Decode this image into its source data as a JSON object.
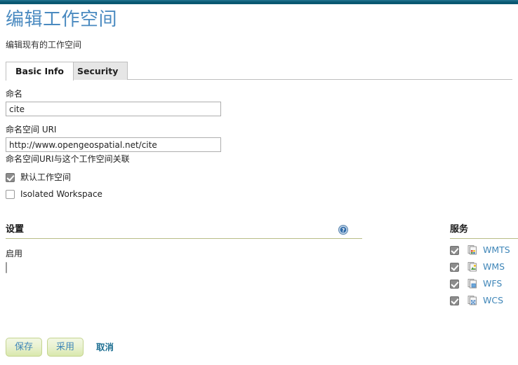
{
  "window": {
    "accent_color": "#0a5872"
  },
  "header": {
    "title": "编辑工作空间",
    "subtitle": "编辑现有的工作空间"
  },
  "tabs": [
    {
      "label": "Basic Info",
      "active": true
    },
    {
      "label": "Security",
      "active": false
    }
  ],
  "form": {
    "name_label": "命名",
    "name_value": "cite",
    "uri_label": "命名空间 URI",
    "uri_value": "http://www.opengeospatial.net/cite",
    "uri_hint": "命名空间URI与这个工作空间关联",
    "default_workspace_label": "默认工作空间",
    "default_workspace_checked": true,
    "isolated_workspace_label": "Isolated Workspace",
    "isolated_workspace_checked": false
  },
  "settings": {
    "title": "设置",
    "help_icon": "help-circle-icon",
    "enable_label": "启用",
    "enable_checked": false
  },
  "services": {
    "title": "服务",
    "items": [
      {
        "label": "WMTS",
        "checked": true,
        "icon": "service-page-icon"
      },
      {
        "label": "WMS",
        "checked": true,
        "icon": "service-page-icon"
      },
      {
        "label": "WFS",
        "checked": true,
        "icon": "service-page-icon"
      },
      {
        "label": "WCS",
        "checked": true,
        "icon": "service-page-icon"
      }
    ]
  },
  "footer": {
    "save_label": "保存",
    "apply_label": "采用",
    "cancel_label": "取消"
  },
  "colors": {
    "title_blue": "#4a8ac0",
    "link_blue": "#3f86b8",
    "section_rule": "#b9bd86",
    "button_green": "#d9e8ac"
  }
}
